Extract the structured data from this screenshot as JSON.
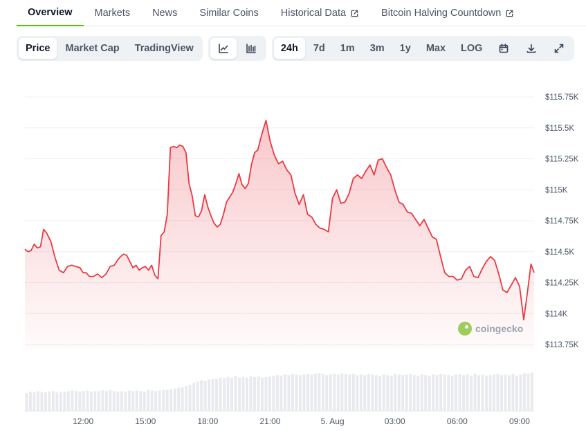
{
  "tabs": [
    {
      "label": "Overview",
      "active": true,
      "external": false
    },
    {
      "label": "Markets",
      "active": false,
      "external": false
    },
    {
      "label": "News",
      "active": false,
      "external": false
    },
    {
      "label": "Similar Coins",
      "active": false,
      "external": false
    },
    {
      "label": "Historical Data",
      "active": false,
      "external": true
    },
    {
      "label": "Bitcoin Halving Countdown",
      "active": false,
      "external": true
    }
  ],
  "chart_type_buttons": [
    {
      "label": "Price",
      "active": true
    },
    {
      "label": "Market Cap",
      "active": false
    },
    {
      "label": "TradingView",
      "active": false
    }
  ],
  "view_buttons": [
    {
      "icon": "line-chart-icon",
      "active": true
    },
    {
      "icon": "candlestick-chart-icon",
      "active": false
    }
  ],
  "range_buttons": [
    {
      "label": "24h",
      "active": true
    },
    {
      "label": "7d",
      "active": false
    },
    {
      "label": "1m",
      "active": false
    },
    {
      "label": "3m",
      "active": false
    },
    {
      "label": "1y",
      "active": false
    },
    {
      "label": "Max",
      "active": false
    },
    {
      "label": "LOG",
      "active": false
    }
  ],
  "tool_buttons": [
    {
      "icon": "calendar-icon"
    },
    {
      "icon": "download-icon"
    },
    {
      "icon": "fullscreen-icon"
    }
  ],
  "watermark": "coingecko",
  "colors": {
    "line": "#ea3943",
    "accent": "#4bcc00",
    "volume": "#e8eaee"
  },
  "chart_data": {
    "type": "area",
    "x_labels": [
      "12:00",
      "15:00",
      "18:00",
      "21:00",
      "5. Aug",
      "03:00",
      "06:00",
      "09:00"
    ],
    "x_label_hours": [
      2,
      5,
      8,
      11,
      14,
      17,
      20,
      23
    ],
    "x_range": [
      -0.8,
      23.7
    ],
    "y_ticks": [
      113750,
      114000,
      114250,
      114500,
      114750,
      115000,
      115250,
      115500,
      115750
    ],
    "y_tick_labels": [
      "$113.75K",
      "$114K",
      "$114.25K",
      "$114.5K",
      "$114.75K",
      "$115K",
      "$115.25K",
      "$115.5K",
      "$115.75K"
    ],
    "ylim": [
      113750,
      115750
    ],
    "grid": true,
    "series": [
      {
        "x": [
          -0.8,
          -0.65,
          -0.5,
          -0.35,
          -0.2,
          -0.05,
          0.1,
          0.25,
          0.45,
          0.65,
          0.85,
          1.05,
          1.25,
          1.45,
          1.65,
          1.85,
          2.0,
          2.15,
          2.3,
          2.5,
          2.7,
          2.9,
          3.1,
          3.3,
          3.5,
          3.65,
          3.8,
          3.95,
          4.1,
          4.25,
          4.4,
          4.55,
          4.7,
          4.85,
          5.0,
          5.15,
          5.3,
          5.45,
          5.6,
          5.75,
          5.9,
          6.05,
          6.2,
          6.35,
          6.5,
          6.65,
          6.8,
          6.95,
          7.1,
          7.25,
          7.4,
          7.55,
          7.7,
          7.85,
          8.0,
          8.15,
          8.3,
          8.45,
          8.6,
          8.75,
          8.9,
          9.05,
          9.2,
          9.35,
          9.5,
          9.65,
          9.8,
          9.95,
          10.1,
          10.25,
          10.4,
          10.6,
          10.8,
          11.0,
          11.2,
          11.4,
          11.6,
          11.8,
          12.0,
          12.2,
          12.4,
          12.6,
          12.8,
          13.0,
          13.2,
          13.4,
          13.6,
          13.8,
          14.0,
          14.2,
          14.4,
          14.6,
          14.8,
          15.0,
          15.2,
          15.4,
          15.6,
          15.8,
          16.0,
          16.2,
          16.4,
          16.6,
          16.8,
          17.0,
          17.2,
          17.4,
          17.6,
          17.8,
          18.0,
          18.2,
          18.4,
          18.6,
          18.8,
          19.0,
          19.2,
          19.4,
          19.6,
          19.8,
          20.0,
          20.2,
          20.4,
          20.6,
          20.8,
          21.0,
          21.2,
          21.4,
          21.6,
          21.8,
          22.0,
          22.2,
          22.4,
          22.6,
          22.8,
          23.0,
          23.2,
          23.4,
          23.55,
          23.7
        ],
        "y": [
          114520,
          114500,
          114510,
          114560,
          114530,
          114540,
          114680,
          114650,
          114580,
          114450,
          114350,
          114330,
          114380,
          114390,
          114380,
          114370,
          114330,
          114330,
          114300,
          114300,
          114320,
          114290,
          114320,
          114380,
          114390,
          114430,
          114460,
          114480,
          114470,
          114420,
          114370,
          114390,
          114350,
          114370,
          114380,
          114350,
          114390,
          114310,
          114280,
          114630,
          114660,
          114800,
          115340,
          115350,
          115340,
          115360,
          115350,
          115300,
          115050,
          114950,
          114790,
          114780,
          114830,
          114960,
          114860,
          114790,
          114730,
          114700,
          114720,
          114800,
          114900,
          114940,
          114980,
          115050,
          115130,
          115040,
          115010,
          115050,
          115200,
          115300,
          115320,
          115450,
          115560,
          115390,
          115280,
          115210,
          115230,
          115160,
          115120,
          114970,
          114880,
          114960,
          114800,
          114780,
          114720,
          114690,
          114680,
          114660,
          114930,
          115000,
          114890,
          114900,
          114970,
          115090,
          115120,
          115090,
          115150,
          115200,
          115120,
          115240,
          115250,
          115180,
          115120,
          115000,
          114900,
          114880,
          114820,
          114810,
          114760,
          114710,
          114760,
          114690,
          114620,
          114600,
          114460,
          114330,
          114300,
          114300,
          114270,
          114280,
          114350,
          114380,
          114300,
          114290,
          114360,
          114420,
          114460,
          114430,
          114320,
          114190,
          114170,
          114230,
          114290,
          114220,
          113950,
          114200,
          114400,
          114330
        ]
      }
    ],
    "volume": [
      28,
      30,
      29,
      31,
      30,
      29,
      30,
      31,
      29,
      30,
      30,
      31,
      32,
      31,
      30,
      31,
      32,
      30,
      31,
      31,
      32,
      31,
      33,
      31,
      30,
      31,
      30,
      32,
      31,
      32,
      31,
      30,
      33,
      32,
      31,
      32,
      33,
      33,
      34,
      35,
      36,
      37,
      39,
      41,
      44,
      46,
      48,
      47,
      49,
      50,
      50,
      52,
      51,
      53,
      52,
      54,
      52,
      53,
      52,
      54,
      53,
      54,
      52,
      53,
      54,
      55,
      56,
      55,
      57,
      56,
      58,
      57,
      56,
      57,
      58,
      57,
      58,
      59,
      58,
      56,
      57,
      58,
      57,
      59,
      58,
      57,
      58,
      56,
      57,
      56,
      58,
      57,
      56,
      55,
      57,
      56,
      55,
      58,
      57,
      56,
      57,
      58,
      56,
      55,
      57,
      56,
      55,
      57,
      56,
      58,
      57,
      56,
      55,
      57,
      58,
      56,
      57,
      55,
      58,
      56,
      57,
      55,
      56,
      57,
      58,
      56,
      57,
      56,
      58,
      55,
      57,
      59,
      58,
      60
    ]
  }
}
